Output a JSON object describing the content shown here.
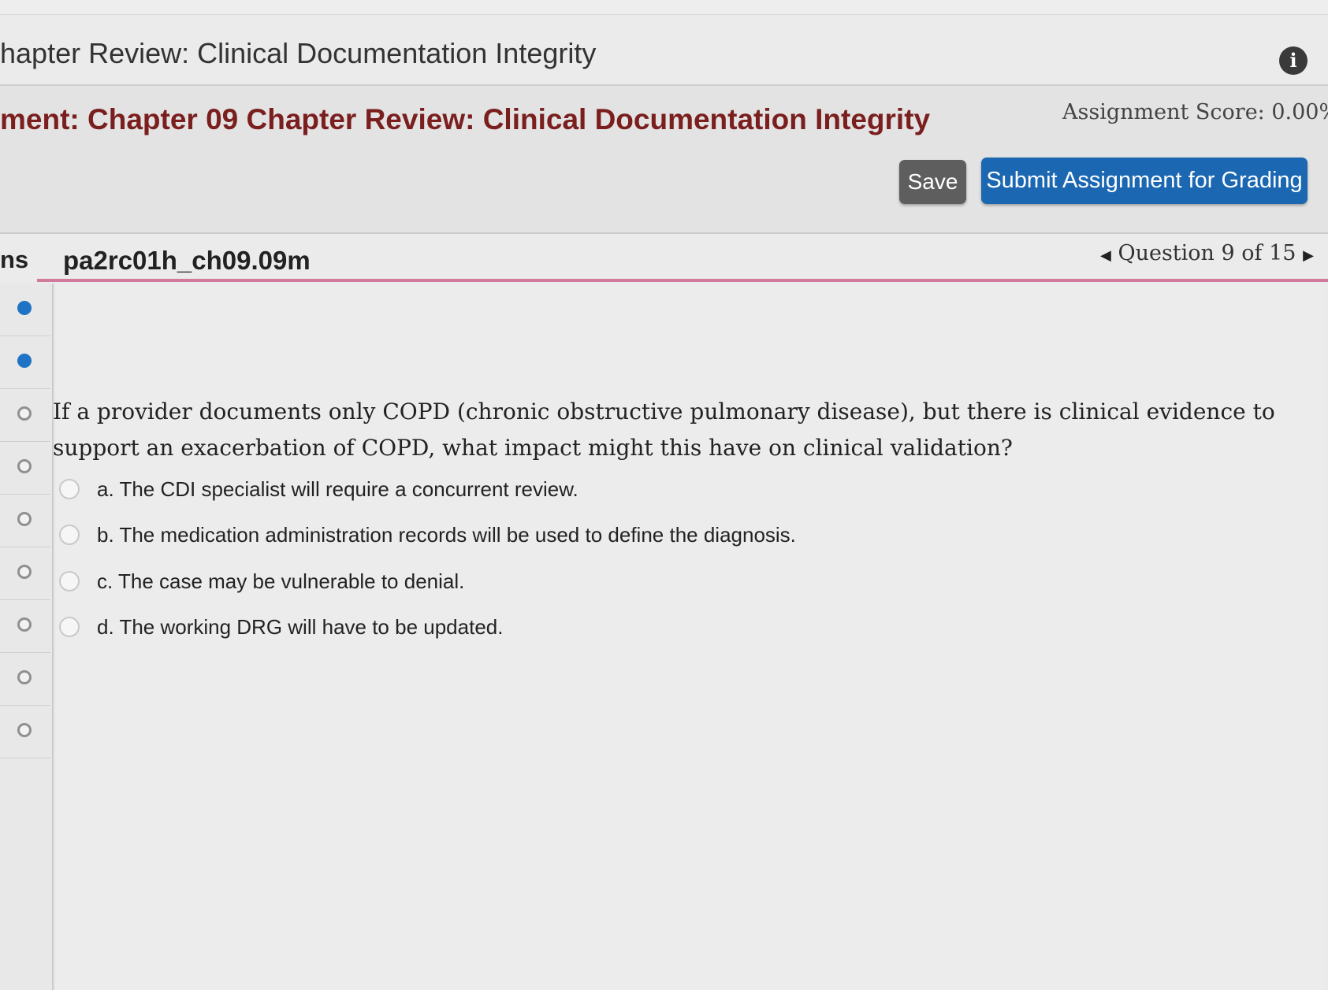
{
  "header": {
    "course_title": "hapter Review: Clinical Documentation Integrity",
    "info_icon": "info-icon"
  },
  "assignment": {
    "title": "ment: Chapter 09 Chapter Review: Clinical Documentation Integrity",
    "score": "Assignment Score: 0.00%",
    "save_label": "Save",
    "submit_label": "Submit Assignment for Grading"
  },
  "question_bar": {
    "tab_fragment": "ns",
    "question_id": "pa2rc01h_ch09.09m",
    "nav_label": "Question 9 of 15",
    "prev_icon": "caret-left-icon",
    "next_icon": "caret-right-icon"
  },
  "sidebar": {
    "items": [
      {
        "status": "answered"
      },
      {
        "status": "answered"
      },
      {
        "status": "unanswered"
      },
      {
        "status": "unanswered"
      },
      {
        "status": "unanswered"
      },
      {
        "status": "unanswered"
      },
      {
        "status": "unanswered"
      },
      {
        "status": "unanswered"
      },
      {
        "status": "unanswered"
      }
    ]
  },
  "question": {
    "text": "If a provider documents only COPD (chronic obstructive pulmonary disease), but there is clinical evidence to support an exacerbation of COPD, what impact might this have on clinical validation?",
    "choices": [
      {
        "label": "a. The CDI specialist will require a concurrent review."
      },
      {
        "label": "b. The medication administration records will be used to define the diagnosis."
      },
      {
        "label": "c. The case may be vulnerable to denial."
      },
      {
        "label": "d. The working DRG will have to be updated."
      }
    ]
  },
  "colors": {
    "assignment_title": "#7a1e1e",
    "submit_button": "#1b67b2",
    "save_button": "#5e5e5e",
    "answered_dot": "#1f73c4",
    "accent_line": "#d27a9b"
  }
}
